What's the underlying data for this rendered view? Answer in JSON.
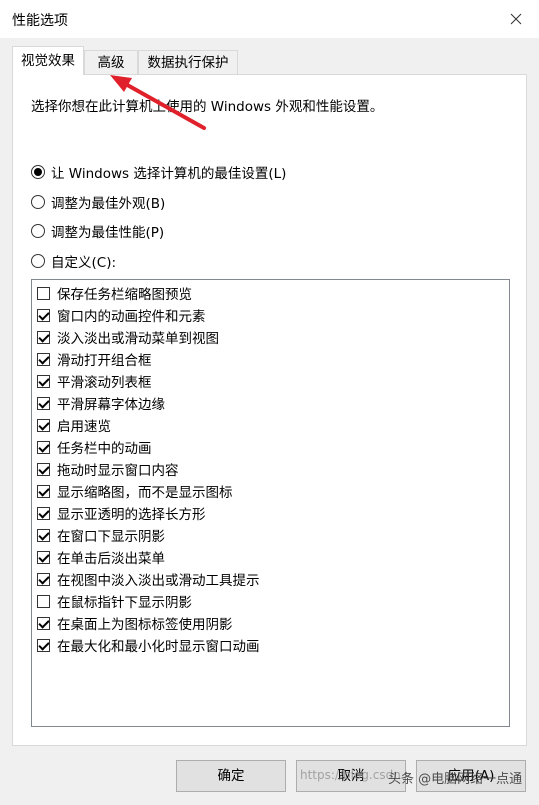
{
  "window": {
    "title": "性能选项"
  },
  "tabs": [
    {
      "label": "视觉效果",
      "active": true
    },
    {
      "label": "高级",
      "active": false
    },
    {
      "label": "数据执行保护",
      "active": false
    }
  ],
  "intro": "选择你想在此计算机上使用的 Windows 外观和性能设置。",
  "radios": [
    {
      "label": "让 Windows 选择计算机的最佳设置(L)",
      "checked": true
    },
    {
      "label": "调整为最佳外观(B)",
      "checked": false
    },
    {
      "label": "调整为最佳性能(P)",
      "checked": false
    },
    {
      "label": "自定义(C):",
      "checked": false
    }
  ],
  "effects": [
    {
      "label": "保存任务栏缩略图预览",
      "checked": false
    },
    {
      "label": "窗口内的动画控件和元素",
      "checked": true
    },
    {
      "label": "淡入淡出或滑动菜单到视图",
      "checked": true
    },
    {
      "label": "滑动打开组合框",
      "checked": true
    },
    {
      "label": "平滑滚动列表框",
      "checked": true
    },
    {
      "label": "平滑屏幕字体边缘",
      "checked": true
    },
    {
      "label": "启用速览",
      "checked": true
    },
    {
      "label": "任务栏中的动画",
      "checked": true
    },
    {
      "label": "拖动时显示窗口内容",
      "checked": true
    },
    {
      "label": "显示缩略图，而不是显示图标",
      "checked": true
    },
    {
      "label": "显示亚透明的选择长方形",
      "checked": true
    },
    {
      "label": "在窗口下显示阴影",
      "checked": true
    },
    {
      "label": "在单击后淡出菜单",
      "checked": true
    },
    {
      "label": "在视图中淡入淡出或滑动工具提示",
      "checked": true
    },
    {
      "label": "在鼠标指针下显示阴影",
      "checked": false
    },
    {
      "label": "在桌面上为图标标签使用阴影",
      "checked": true
    },
    {
      "label": "在最大化和最小化时显示窗口动画",
      "checked": true
    }
  ],
  "buttons": {
    "ok": "确定",
    "cancel": "取消",
    "apply": "应用(A)"
  },
  "overlay": {
    "watermark": "https://blog.csdn",
    "brand": "头条 @电脑网络一点通",
    "arrow_color": "#e0202a"
  }
}
